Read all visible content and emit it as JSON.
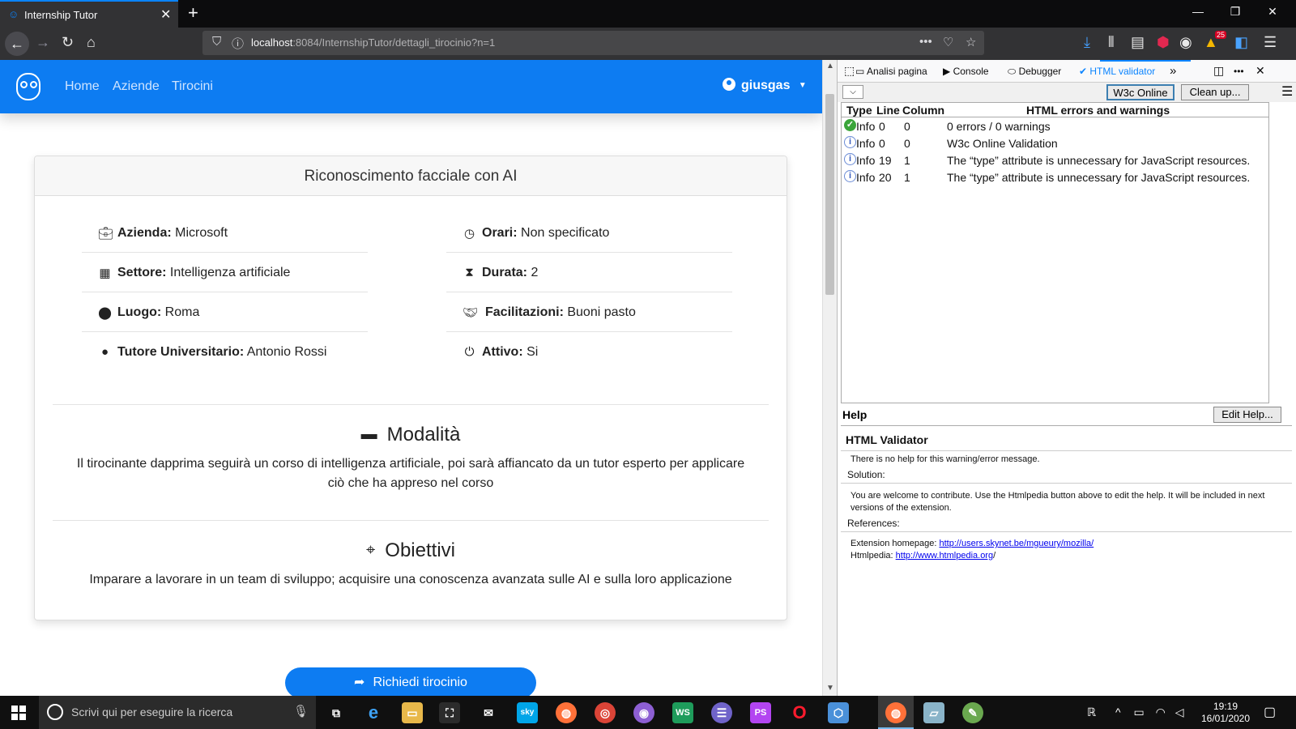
{
  "browser": {
    "tab_title": "Internship Tutor",
    "url_host": "localhost",
    "url_rest": ":8084/InternshipTutor/dettagli_tirocinio?n=1",
    "addon_badge": "25"
  },
  "site": {
    "nav": [
      "Home",
      "Aziende",
      "Tirocini"
    ],
    "user": "giusgas",
    "card_title": "Riconoscimento facciale con AI",
    "details": [
      {
        "label": "Azienda:",
        "value": "Microsoft",
        "icon": "briefcase-icon"
      },
      {
        "label": "Orari:",
        "value": "Non specificato",
        "icon": "clock-icon"
      },
      {
        "label": "Settore:",
        "value": "Intelligenza artificiale",
        "icon": "building-icon"
      },
      {
        "label": "Durata:",
        "value": "2",
        "icon": "hourglass-icon"
      },
      {
        "label": "Luogo:",
        "value": "Roma",
        "icon": "map-marker-icon"
      },
      {
        "label": "Facilitazioni:",
        "value": "Buoni pasto",
        "icon": "handshake-icon"
      },
      {
        "label": "Tutore Universitario:",
        "value": "Antonio Rossi",
        "icon": "user-icon"
      },
      {
        "label": "Attivo:",
        "value": "Si",
        "icon": "power-icon"
      }
    ],
    "modalita": {
      "title": "Modalità",
      "text": "Il tirocinante dapprima seguirà un corso di intelligenza artificiale, poi sarà affiancato da un tutor esperto per applicare ciò che ha appreso nel corso"
    },
    "obiettivi": {
      "title": "Obiettivi",
      "text": "Imparare a lavorare in un team di sviluppo; acquisire una conoscenza avanzata sulle AI e sulla loro applicazione"
    },
    "request_button": "Richiedi tirocinio"
  },
  "devtools": {
    "tabs": [
      "Analisi pagina",
      "Console",
      "Debugger",
      "HTML validator"
    ],
    "validator": {
      "w3c_button": "W3c Online",
      "clean_button": "Clean up...",
      "headers": {
        "type": "Type",
        "line": "Line",
        "column": "Column",
        "message": "HTML errors and warnings"
      },
      "rows": [
        {
          "type": "Info",
          "line": "0",
          "column": "0",
          "message": "0 errors / 0 warnings",
          "status": "ok"
        },
        {
          "type": "Info",
          "line": "0",
          "column": "0",
          "message": "W3c Online Validation",
          "status": "info"
        },
        {
          "type": "Info",
          "line": "19",
          "column": "1",
          "message": "The “type” attribute is unnecessary for JavaScript resources.",
          "status": "info"
        },
        {
          "type": "Info",
          "line": "20",
          "column": "1",
          "message": "The “type” attribute is unnecessary for JavaScript resources.",
          "status": "info"
        }
      ]
    },
    "help": {
      "label": "Help",
      "edit_button": "Edit Help...",
      "title": "HTML Validator",
      "no_help": "There is no help for this warning/error message.",
      "solution_label": "Solution:",
      "solution_text_1": "You are welcome to contribute. Use the Htmlpedia button above to edit the help. It will be included in next",
      "solution_text_2": "versions of the extension.",
      "references_label": "References:",
      "ext_label": "Extension homepage: ",
      "ext_link": "http://users.skynet.be/mgueury/mozilla/",
      "htmlpedia_label": "Htmlpedia: ",
      "htmlpedia_link": "http://www.htmlpedia.org",
      "htmlpedia_suffix": "/"
    }
  },
  "taskbar": {
    "search_placeholder": "Scrivi qui per eseguire la ricerca",
    "time": "19:19",
    "date": "16/01/2020"
  }
}
